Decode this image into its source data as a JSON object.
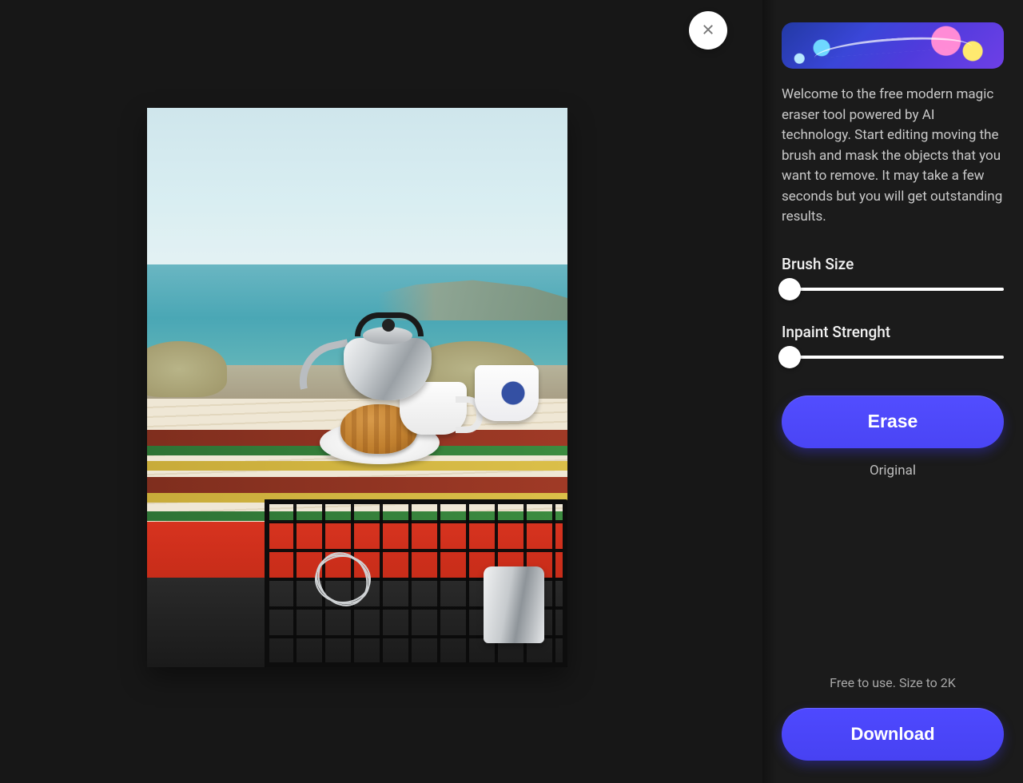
{
  "intro_text": "Welcome to the free modern magic eraser tool powered by AI technology. Start editing moving the brush and mask the objects that you want to remove. It may take a few seconds but you will get outstanding results.",
  "controls": {
    "brush_label": "Brush Size",
    "strength_label": "Inpaint Strenght"
  },
  "actions": {
    "erase_label": "Erase",
    "original_label": "Original",
    "download_label": "Download"
  },
  "footnote": "Free to use. Size to 2K"
}
